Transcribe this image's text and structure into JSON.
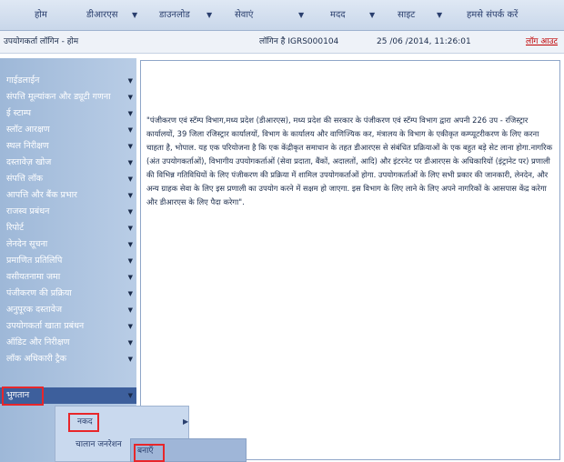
{
  "nav": {
    "items": [
      "होम",
      "डीआरएस",
      "डाउनलोड",
      "सेवाएं",
      "मदद",
      "साइट",
      "हमसे संपर्क करें"
    ],
    "arrow_glyph": "▼"
  },
  "info": {
    "breadcrumb": "उपयोगकर्ता लॉगिन - होम",
    "login_id": "लॉगिन है IGRS000104",
    "datetime": "25 /06 /2014, 11:26:01",
    "logout": "लॉग आउट"
  },
  "sidebar": {
    "items": [
      "गाईडलाईन",
      "संपत्ति मूल्यांकन और ड्यूटी गणना",
      "ई स्टाम्प",
      "स्लॉट आरक्षण",
      "स्थल निरीक्षण",
      "दस्तावेज़ खोज",
      "संपत्ति लॉक",
      "आपत्ति और बैंक प्रभार",
      "राजस्व प्रबंधन",
      "रिपोर्ट",
      "लेनदेन सूचना",
      "प्रमाणित प्रतिलिपि",
      "वसीयतनामा जमा",
      "पंजीकरण की प्रक्रिया",
      "अनुपूरक दस्तावेज",
      "उपयोगकर्ता खाता प्रबंधन",
      "ऑडिट और निरीक्षण",
      "लॉक अधिकारी ट्रैक",
      "भुगतान"
    ],
    "arrow_glyph": "▼"
  },
  "content": {
    "paragraph": "\"पंजीकरण एवं स्टॅम्प विभाग,मध्य प्रदेश (डीआरएस), मध्य प्रदेश की सरकार के पंजीकरण एवं स्टॅम्प विभाग द्वारा अपनी 226 उप - रजिस्ट्रार कार्यालयों, 39 जिला रजिस्ट्रार कार्यालयों, विभाग के कार्यालय और वाणिज्यिक कर, मंत्रालय के विभाग के एकीकृत कम्प्यूटरीकरण के लिए करना चाहता है, भोपाल. यह एक परियोजना है कि एक केंद्रीकृत समाधान के तहत डीआरएस से संबंधित प्रक्रियाओं के एक बहुत बड़े सेट लाना होगा.नागरिक (अंत उपयोगकर्ताओं), विभागीय उपयोगकर्ताओं (सेवा प्रदाता, बैंकों, अदालतों, आदि) और इंटरनेट पर डीआरएस के अधिकारियों (इंट्रानेट पर) प्रणाली की विभिन्न गतिविधियों के लिए पंजीकरण की प्रक्रिया में शामिल उपयोगकर्ताओं होगा. उपयोगकर्ताओं के लिए सभी प्रकार की जानकारी, लेनदेन, और अन्य ग्राहक सेवा के लिए इस प्रणाली का उपयोग करने में सक्षम हो जाएगा. इस विभाग के लिए लाने के लिए अपने नागरिकों के आसपास केंद्र करेगा और डीआरएस के लिए पैदा करेगा\"."
  },
  "flyout": {
    "items": [
      "नकद",
      "चालान जनरेशन"
    ],
    "arrow_glyph": "▶",
    "sub_items": [
      "बनाएँ"
    ]
  }
}
